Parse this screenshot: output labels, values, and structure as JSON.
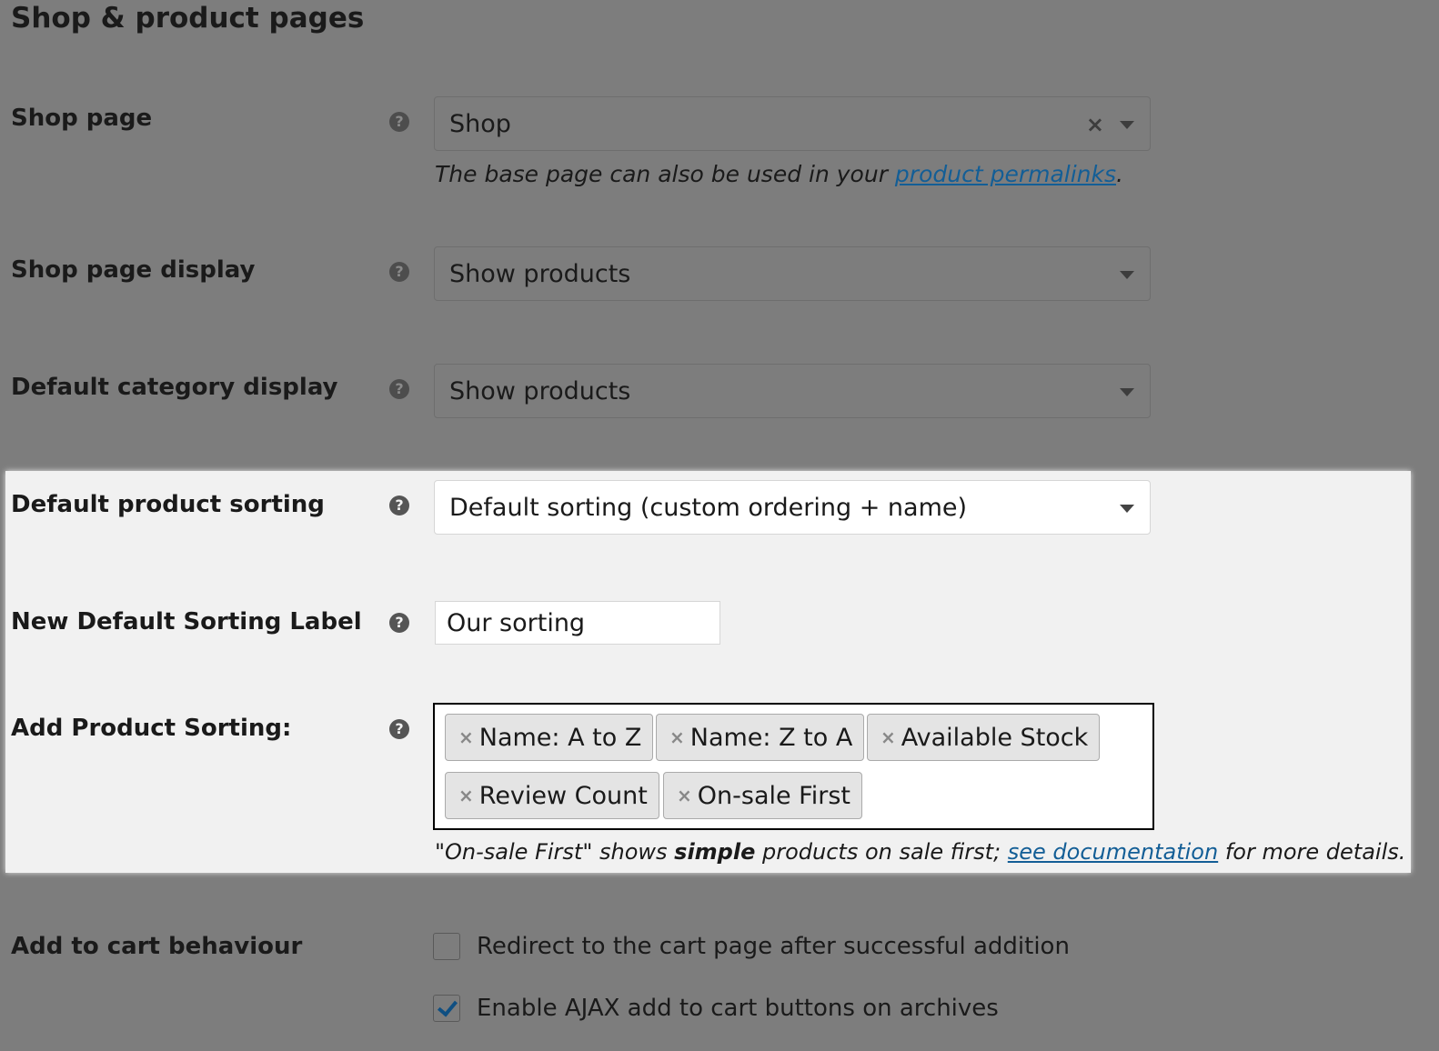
{
  "section_title": "Shop & product pages",
  "help_glyph": "?",
  "shop_page": {
    "label": "Shop page",
    "value": "Shop",
    "clear_glyph": "×",
    "description_prefix": "The base page can also be used in your ",
    "description_link": "product permalinks",
    "description_suffix": "."
  },
  "shop_page_display": {
    "label": "Shop page display",
    "value": "Show products"
  },
  "default_category_display": {
    "label": "Default category display",
    "value": "Show products"
  },
  "default_product_sorting": {
    "label": "Default product sorting",
    "value": "Default sorting (custom ordering + name)"
  },
  "new_default_sorting_label": {
    "label": "New Default Sorting Label",
    "value": "Our sorting"
  },
  "add_product_sorting": {
    "label": "Add Product Sorting:",
    "tag_remove_glyph": "×",
    "tags": [
      "Name: A to Z",
      "Name: Z to A",
      "Available Stock",
      "Review Count",
      "On-sale First"
    ],
    "note_prefix": "\"On-sale First\" shows ",
    "note_bold": "simple",
    "note_middle": " products on sale first; ",
    "note_link": "see documentation",
    "note_suffix": " for more details."
  },
  "add_to_cart_behaviour": {
    "label": "Add to cart behaviour",
    "options": [
      {
        "label": "Redirect to the cart page after successful addition",
        "checked": false
      },
      {
        "label": "Enable AJAX add to cart buttons on archives",
        "checked": true
      }
    ]
  },
  "colors": {
    "overlay_background": "#7d7d7d",
    "highlight_background": "#f1f1f1",
    "link": "#135e96",
    "checkmark": "#0f4f82"
  }
}
